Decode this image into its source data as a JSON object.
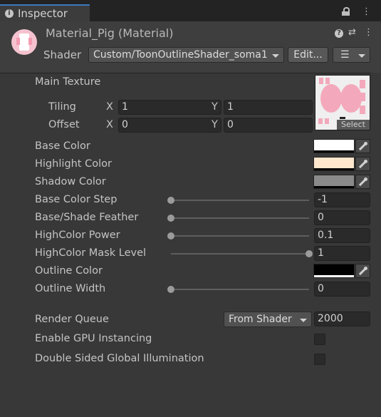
{
  "tab": {
    "title": "Inspector",
    "info_glyph": "i"
  },
  "window_controls": {
    "menu": "⋮"
  },
  "material": {
    "title": "Material_Pig (Material)",
    "help_glyph": "?",
    "settings_glyph": "⇄",
    "menu_glyph": "⋮"
  },
  "shader": {
    "label": "Shader",
    "value": "Custom/ToonOutlineShader_soma1",
    "edit_label": "Edit...",
    "list_glyph": "☰"
  },
  "main_texture": {
    "label": "Main Texture",
    "select_label": "Select",
    "tiling": {
      "label": "Tiling",
      "x_label": "X",
      "x": "1",
      "y_label": "Y",
      "y": "1"
    },
    "offset": {
      "label": "Offset",
      "x_label": "X",
      "x": "0",
      "y_label": "Y",
      "y": "0"
    }
  },
  "colors": {
    "base": {
      "label": "Base Color",
      "color": "#ffffff"
    },
    "highlight": {
      "label": "Highlight Color",
      "color": "#ffe7cd"
    },
    "shadow": {
      "label": "Shadow Color",
      "color": "#8a8a8a"
    },
    "outline": {
      "label": "Outline Color",
      "color": "#000000"
    }
  },
  "sliders": {
    "base_color_step": {
      "label": "Base Color Step",
      "value": "-1",
      "fraction": 0
    },
    "base_shade_feather": {
      "label": "Base/Shade Feather",
      "value": "0",
      "fraction": 0
    },
    "highcolor_power": {
      "label": "HighColor Power",
      "value": "0.1",
      "fraction": 0
    },
    "highcolor_mask_level": {
      "label": "HighColor Mask Level",
      "value": "1",
      "fraction": 1
    },
    "outline_width": {
      "label": "Outline Width",
      "value": "0",
      "fraction": 0
    }
  },
  "render_queue": {
    "label": "Render Queue",
    "mode": "From Shader",
    "value": "2000"
  },
  "gpu_instancing": {
    "label": "Enable GPU Instancing",
    "checked": false
  },
  "double_sided_gi": {
    "label": "Double Sided Global Illumination",
    "checked": false
  }
}
